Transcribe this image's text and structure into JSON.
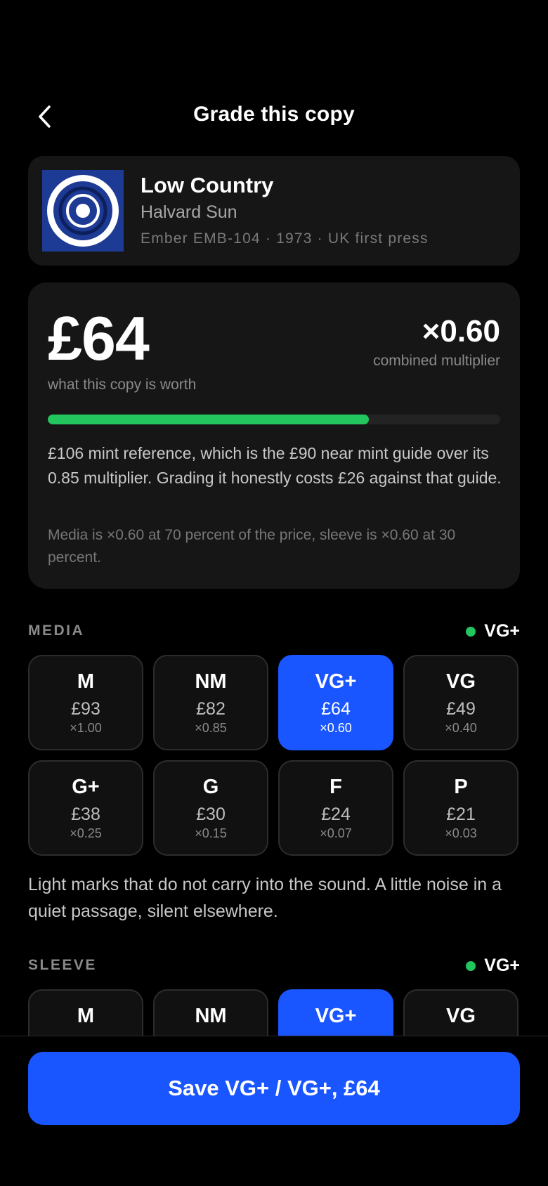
{
  "header": {
    "title": "Grade this copy",
    "back_icon": "chevron-left-icon"
  },
  "record": {
    "title": "Low Country",
    "artist": "Halvard Sun",
    "meta": "Ember EMB-104 · 1973 · UK first press"
  },
  "valuation": {
    "price": "£64",
    "price_caption": "what this copy is worth",
    "multiplier": "×0.60",
    "multiplier_caption": "combined multiplier",
    "progress_fraction": 0.71,
    "explanation": "£106 mint reference, which is the £90 near mint guide over its 0.85 multiplier. Grading it honestly costs £26 against that guide.",
    "weights": "Media is ×0.60 at 70 percent of the price, sleeve is ×0.60 at 30 percent."
  },
  "media": {
    "label": "MEDIA",
    "selected_grade": "VG+",
    "grades": [
      {
        "grade": "M",
        "price": "£93",
        "mult": "×1.00",
        "selected": false
      },
      {
        "grade": "NM",
        "price": "£82",
        "mult": "×0.85",
        "selected": false
      },
      {
        "grade": "VG+",
        "price": "£64",
        "mult": "×0.60",
        "selected": true
      },
      {
        "grade": "VG",
        "price": "£49",
        "mult": "×0.40",
        "selected": false
      },
      {
        "grade": "G+",
        "price": "£38",
        "mult": "×0.25",
        "selected": false
      },
      {
        "grade": "G",
        "price": "£30",
        "mult": "×0.15",
        "selected": false
      },
      {
        "grade": "F",
        "price": "£24",
        "mult": "×0.07",
        "selected": false
      },
      {
        "grade": "P",
        "price": "£21",
        "mult": "×0.03",
        "selected": false
      }
    ],
    "description": "Light marks that do not carry into the sound. A little noise in a quiet passage, silent elsewhere."
  },
  "sleeve": {
    "label": "SLEEVE",
    "selected_grade": "VG+",
    "grades": [
      {
        "grade": "M",
        "selected": false
      },
      {
        "grade": "NM",
        "selected": false
      },
      {
        "grade": "VG+",
        "selected": true
      },
      {
        "grade": "VG",
        "selected": false
      }
    ]
  },
  "save_button": {
    "label": "Save VG+ / VG+, £64"
  },
  "colors": {
    "accent": "#1a56ff",
    "positive": "#22c55e",
    "card": "#161616",
    "background": "#000000"
  }
}
